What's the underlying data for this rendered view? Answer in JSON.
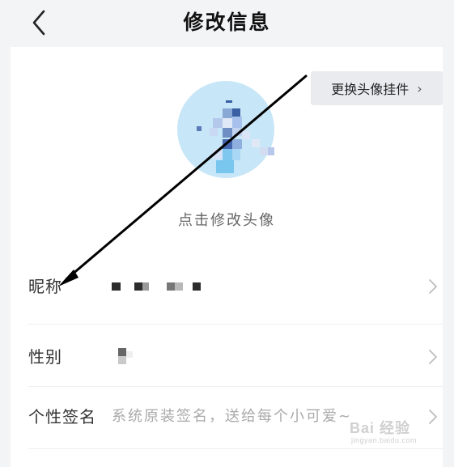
{
  "header": {
    "title": "修改信息",
    "back_icon": "chevron-left-icon"
  },
  "avatar": {
    "pendant_button_label": "更换头像挂件",
    "pendant_chevron": "›",
    "caption": "点击修改头像",
    "bg_color": "#c7e6f7"
  },
  "rows": [
    {
      "label": "昵称",
      "value": ""
    },
    {
      "label": "性别",
      "value": ""
    },
    {
      "label": "个性签名",
      "value": "系统原装签名，送给每个小可爱~"
    }
  ],
  "watermark": {
    "main": "Bai 经验",
    "sub": "jingyan.baidu.com"
  },
  "colors": {
    "background": "#f3f4f6",
    "card": "#ffffff",
    "pendant_bg": "#e9ebef",
    "annotation_arrow": "#000000"
  }
}
